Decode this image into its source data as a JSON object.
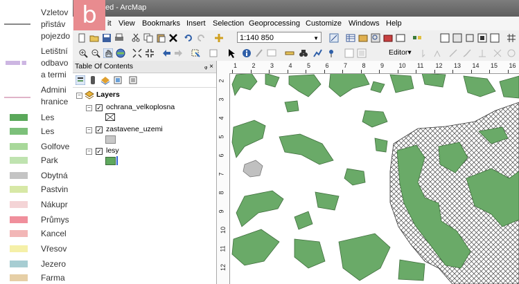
{
  "panel_label": "b",
  "legend": {
    "items": [
      {
        "label": "Vzletov\npřistáv\npojezdo",
        "color": "#888888",
        "symbol": "line"
      },
      {
        "label": "Letištní\nodbavo\na termi",
        "color": "#cdb6e2",
        "symbol": "dash"
      },
      {
        "label": "Admini\nhranice",
        "color": "#e0b3c8",
        "symbol": "line"
      },
      {
        "label": "Les",
        "color": "#5aa85a",
        "symbol": "rect"
      },
      {
        "label": "Les",
        "color": "#7cc07a",
        "symbol": "rect"
      },
      {
        "label": "Golfove",
        "color": "#a8d89a",
        "symbol": "rect"
      },
      {
        "label": "Park",
        "color": "#bfe3b0",
        "symbol": "rect"
      },
      {
        "label": "Obytná",
        "color": "#c4c4c4",
        "symbol": "rect"
      },
      {
        "label": "Pastvin",
        "color": "#d7e8a6",
        "symbol": "rect"
      },
      {
        "label": "Nákupr",
        "color": "#f4d4d6",
        "symbol": "rect"
      },
      {
        "label": "Průmys",
        "color": "#f08f9c",
        "symbol": "rect"
      },
      {
        "label": "Kancel",
        "color": "#f2b6b6",
        "symbol": "rect"
      },
      {
        "label": "Vřesov",
        "color": "#f5f0a8",
        "symbol": "rect"
      },
      {
        "label": "Jezero",
        "color": "#a7cdd2",
        "symbol": "rect"
      },
      {
        "label": "Farma",
        "color": "#e6cfa6",
        "symbol": "rect"
      }
    ]
  },
  "window": {
    "title": "ed - ArcMap",
    "menu": [
      "it",
      "View",
      "Bookmarks",
      "Insert",
      "Selection",
      "Geoprocessing",
      "Customize",
      "Windows",
      "Help"
    ],
    "scale": "1:140 850",
    "editor_label": "Editor▾"
  },
  "toc": {
    "title": "Table Of Contents",
    "pin": "ᵩ ×",
    "root_label": "Layers",
    "layers": [
      {
        "name": "ochrana_velkoplosna",
        "checked": true,
        "swatch": "#ffffff",
        "hatched": true
      },
      {
        "name": "zastavene_uzemi",
        "checked": true,
        "swatch": "#c8c8c8",
        "hatched": false
      },
      {
        "name": "lesy",
        "checked": true,
        "swatch": "#5fa85e",
        "hatched": false
      }
    ]
  },
  "ruler": {
    "h": [
      "1",
      "2",
      "3",
      "4",
      "5",
      "6",
      "7",
      "8",
      "9",
      "10",
      "11",
      "12",
      "13",
      "14",
      "15",
      "16"
    ],
    "v": [
      "2",
      "3",
      "4",
      "5",
      "6",
      "7",
      "8",
      "9",
      "10",
      "11",
      "12"
    ]
  },
  "map_colors": {
    "forest": "#6aaa68",
    "forest_stroke": "#3f6e3d",
    "urban": "#c0c0c0",
    "hatch": "#444444"
  }
}
